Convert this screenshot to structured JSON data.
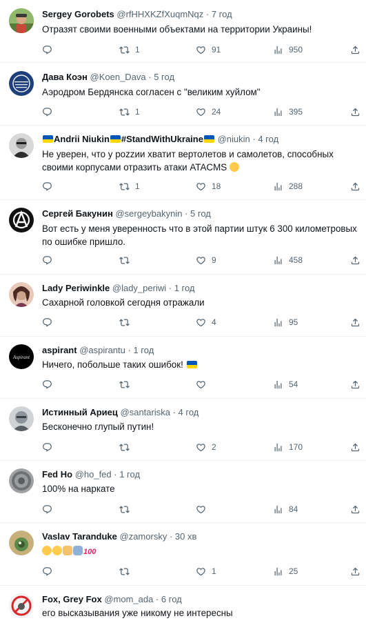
{
  "tweets": [
    {
      "name": "Sergey Gorobets",
      "handle": "@rfHHXKZfXuqmNqz",
      "sep": " · ",
      "time": "7 год",
      "text": "Отразят своими военными объектами на территории Украины!",
      "retweets": "1",
      "likes": "91",
      "views": "950"
    },
    {
      "name": "Дава Коэн",
      "handle": "@Koen_Dava",
      "sep": " · ",
      "time": "5 год",
      "text": "Аэродром Бердянска согласен с \"великим хуйлом\"",
      "retweets": "1",
      "likes": "24",
      "views": "395"
    },
    {
      "name_part1": "Andrii Niukin",
      "name_part2": "#StandWithUkraine",
      "handle": "@niukin",
      "sep": " · ",
      "time": "4 год",
      "text": "Не уверен, что у роzzии хватит вертолетов и самолетов, способных своими корпусами отразить атаки ATACMS",
      "retweets": "1",
      "likes": "18",
      "views": "288"
    },
    {
      "name": "Сергей Бакунин",
      "handle": "@sergeybakynin",
      "sep": " · ",
      "time": "5 год",
      "text": "Вот есть у меня уверенность что в этой партии штук 6 300 километровых по ошибке пришло.",
      "likes": "9",
      "views": "458"
    },
    {
      "name": "Lady Periwinkle",
      "handle": "@lady_periwi",
      "sep": " · ",
      "time": "1 год",
      "text": "Сахарной головкой сегодня отражали",
      "likes": "4",
      "views": "95"
    },
    {
      "name": "aspirant",
      "handle": "@aspirantu",
      "sep": " · ",
      "time": "1 год",
      "text": "Ничего, побольше таких ошибок!",
      "views": "54",
      "avatar_label": "Aspirant"
    },
    {
      "name": "Истинный Ариец",
      "handle": "@santariska",
      "sep": " · ",
      "time": "4 год",
      "text": "Бесконечно глупый путин!",
      "likes": "2",
      "views": "170"
    },
    {
      "name": "Fed Ho",
      "handle": "@ho_fed",
      "sep": " · ",
      "time": "1 год",
      "text": "100% на наркате",
      "views": "84"
    },
    {
      "name": "Vaslav Taranduke",
      "handle": "@zamorsky",
      "sep": " · ",
      "time": "30 хв",
      "emoji_100": "100",
      "likes": "1",
      "views": "25"
    },
    {
      "name": "Fox, Grey Fox",
      "handle": "@mom_ada",
      "sep": " · ",
      "time": "6 год",
      "text": "его высказывания уже никому не интересны"
    }
  ],
  "icons": {
    "reply": "reply-icon",
    "retweet": "retweet-icon",
    "like": "heart-icon",
    "views": "views-icon",
    "share": "share-icon"
  },
  "colors": {
    "text": "#0f1419",
    "muted": "#536471",
    "divider": "#eff3f4",
    "flag_blue": "#0057b7",
    "flag_yellow": "#ffd700"
  }
}
